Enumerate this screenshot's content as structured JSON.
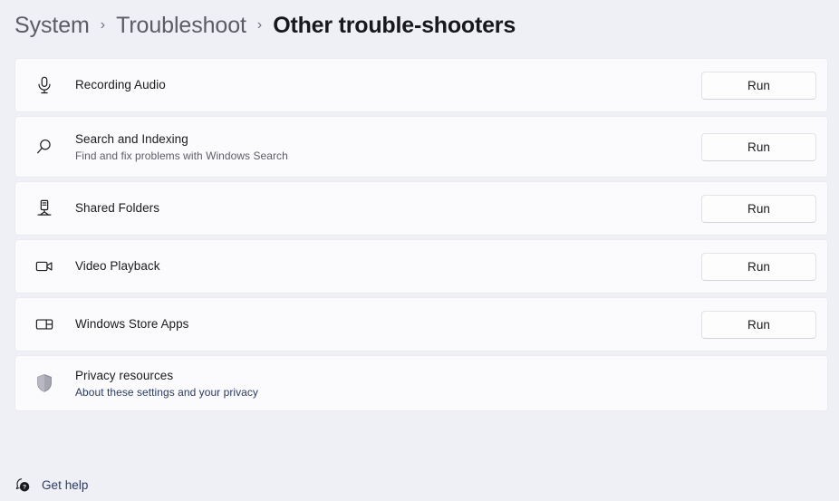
{
  "breadcrumb": {
    "items": [
      {
        "label": "System",
        "current": false
      },
      {
        "label": "Troubleshoot",
        "current": false
      },
      {
        "label": "Other trouble-shooters",
        "current": true
      }
    ],
    "separator": "›"
  },
  "colors": {
    "page_background": "#eff0f6",
    "card_background": "#fbfbfd",
    "card_border": "#ebebf0",
    "title_text": "#1b1b1f",
    "muted_text": "#5d5d68",
    "link_text": "#2b3a67",
    "button_background": "#fdfdfe",
    "button_border": "#e2e2e8",
    "shield_icon": "#9a9aa4"
  },
  "troubleshooters": [
    {
      "title": "Recording Audio",
      "subtitle": "",
      "icon": "microphone-icon",
      "action_label": "Run"
    },
    {
      "title": "Search and Indexing",
      "subtitle": "Find and fix problems with Windows Search",
      "icon": "search-icon",
      "action_label": "Run"
    },
    {
      "title": "Shared Folders",
      "subtitle": "",
      "icon": "network-share-icon",
      "action_label": "Run"
    },
    {
      "title": "Video Playback",
      "subtitle": "",
      "icon": "video-camera-icon",
      "action_label": "Run"
    },
    {
      "title": "Windows Store Apps",
      "subtitle": "",
      "icon": "store-apps-icon",
      "action_label": "Run"
    }
  ],
  "privacy": {
    "title": "Privacy resources",
    "link_label": "About these settings and your privacy",
    "icon": "shield-icon"
  },
  "footer": {
    "help_label": "Get help",
    "icon": "help-question-icon"
  }
}
